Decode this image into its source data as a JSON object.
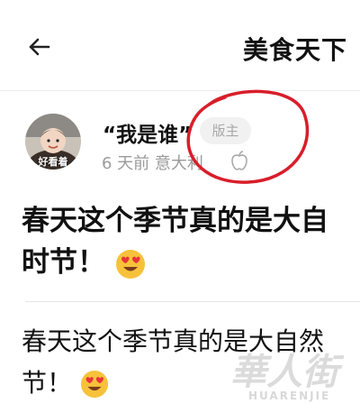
{
  "header": {
    "title": "美食天下"
  },
  "post": {
    "author": "“我是谁”",
    "badge": "版主",
    "meta": "6 天前 意大利",
    "avatar_label": "好看着",
    "title_line1": "春天这个季节真的是大自",
    "title_line2": "时节！",
    "body_line1": "春天这个季节真的是大自然",
    "body_line2": "节！"
  },
  "watermark": {
    "brand": "華人街",
    "subtext": "HUARENJIE"
  },
  "icons": [
    "back-arrow-icon",
    "apple-icon",
    "heart-eyes-emoji"
  ],
  "colors": {
    "annotation_circle": "#d81e2a",
    "badge_bg": "#f1f1f1",
    "meta_text": "#9b9b9b"
  }
}
